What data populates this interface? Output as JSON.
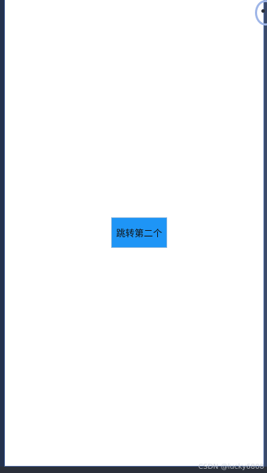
{
  "app": {
    "button_label": "跳转第二个"
  },
  "watermark": {
    "text": "CSDN @lucky6808"
  },
  "colors": {
    "button_bg": "#1e95f6",
    "button_border": "#8ab6de",
    "canvas_bg": "#ffffff",
    "frame_border": "#5570a8"
  },
  "icons": {
    "corner": "window-corner-icon"
  }
}
